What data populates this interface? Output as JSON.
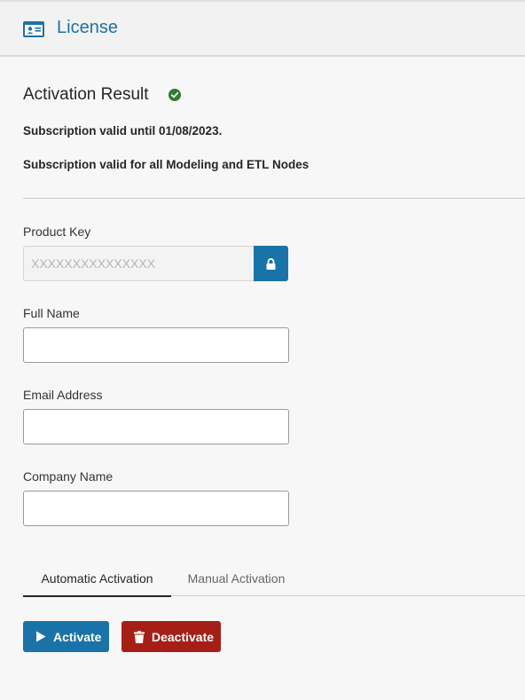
{
  "header": {
    "title": "License",
    "icon": "id-card-icon"
  },
  "result": {
    "title": "Activation Result",
    "status_icon": "check-circle-icon",
    "line1": "Subscription valid until 01/08/2023.",
    "line2": "Subscription valid for all Modeling and ETL Nodes"
  },
  "form": {
    "product_key": {
      "label": "Product Key",
      "placeholder": "XXXXXXXXXXXXXXX",
      "value": ""
    },
    "full_name": {
      "label": "Full Name",
      "value": ""
    },
    "email": {
      "label": "Email Address",
      "value": ""
    },
    "company": {
      "label": "Company Name",
      "value": ""
    }
  },
  "tabs": [
    {
      "label": "Automatic Activation",
      "active": true
    },
    {
      "label": "Manual Activation",
      "active": false
    }
  ],
  "actions": {
    "activate_label": "Activate",
    "deactivate_label": "Deactivate"
  },
  "colors": {
    "accent": "#1a73a8",
    "danger": "#a51f17",
    "success": "#2e7d32"
  }
}
